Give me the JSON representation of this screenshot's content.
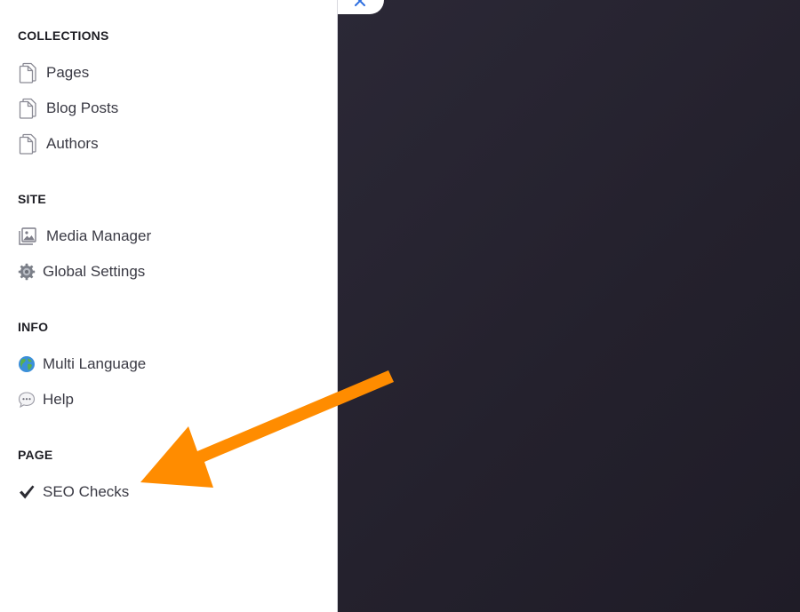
{
  "sidebar": {
    "sections": [
      {
        "title": "COLLECTIONS",
        "items": [
          {
            "label": "Pages",
            "icon": "document-icon"
          },
          {
            "label": "Blog Posts",
            "icon": "document-icon"
          },
          {
            "label": "Authors",
            "icon": "document-icon"
          }
        ]
      },
      {
        "title": "SITE",
        "items": [
          {
            "label": "Media Manager",
            "icon": "image-gallery-icon"
          },
          {
            "label": "Global Settings",
            "icon": "gear-icon"
          }
        ]
      },
      {
        "title": "INFO",
        "items": [
          {
            "label": "Multi Language",
            "icon": "globe-icon"
          },
          {
            "label": "Help",
            "icon": "speech-bubble-icon"
          }
        ]
      },
      {
        "title": "PAGE",
        "items": [
          {
            "label": "SEO Checks",
            "icon": "checkmark-icon"
          }
        ]
      }
    ]
  },
  "colors": {
    "arrow": "#ff8c00",
    "overlay": "#26232f",
    "close_icon": "#2f6fe0"
  }
}
